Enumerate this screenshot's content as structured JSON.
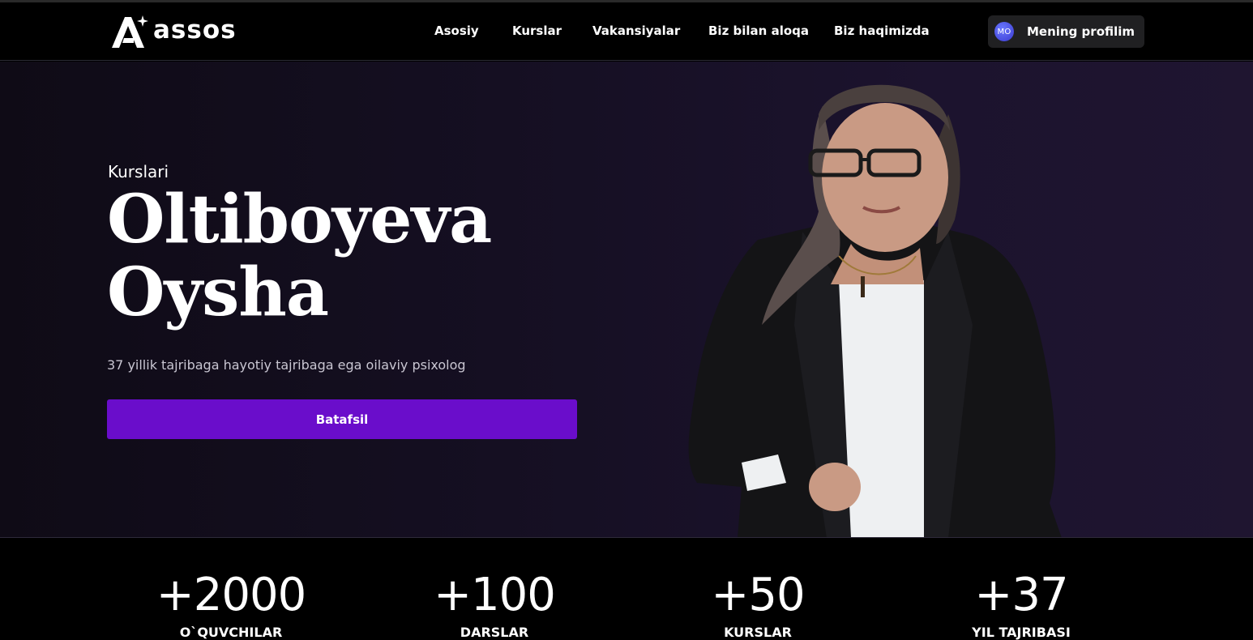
{
  "brand": {
    "name": "assos"
  },
  "nav": {
    "items": [
      {
        "label": "Asosiy"
      },
      {
        "label": "Kurslar"
      },
      {
        "label": "Vakansiyalar"
      },
      {
        "label": "Biz bilan aloqa"
      },
      {
        "label": "Biz haqimizda"
      }
    ],
    "profile": {
      "avatar_initials": "MO",
      "label": "Mening profilim"
    }
  },
  "hero": {
    "eyebrow": "Kurslari",
    "title_line1": "Oltiboyeva",
    "title_line2": "Oysha",
    "subtitle": "37 yillik tajribaga hayotiy tajribaga ega oilaviy psixolog",
    "cta_label": "Batafsil",
    "portrait_icon": "person-portrait-photo"
  },
  "stats": [
    {
      "value": "+2000",
      "label": "O`QUVCHILAR"
    },
    {
      "value": "+100",
      "label": "DARSLAR"
    },
    {
      "value": "+50",
      "label": "KURSLAR"
    },
    {
      "value": "+37",
      "label": "YIL TAJRIBASI"
    }
  ],
  "colors": {
    "accent": "#6a0dcb",
    "background": "#000000",
    "hero_bg": "#150f22",
    "profile_button_bg": "#202022"
  }
}
